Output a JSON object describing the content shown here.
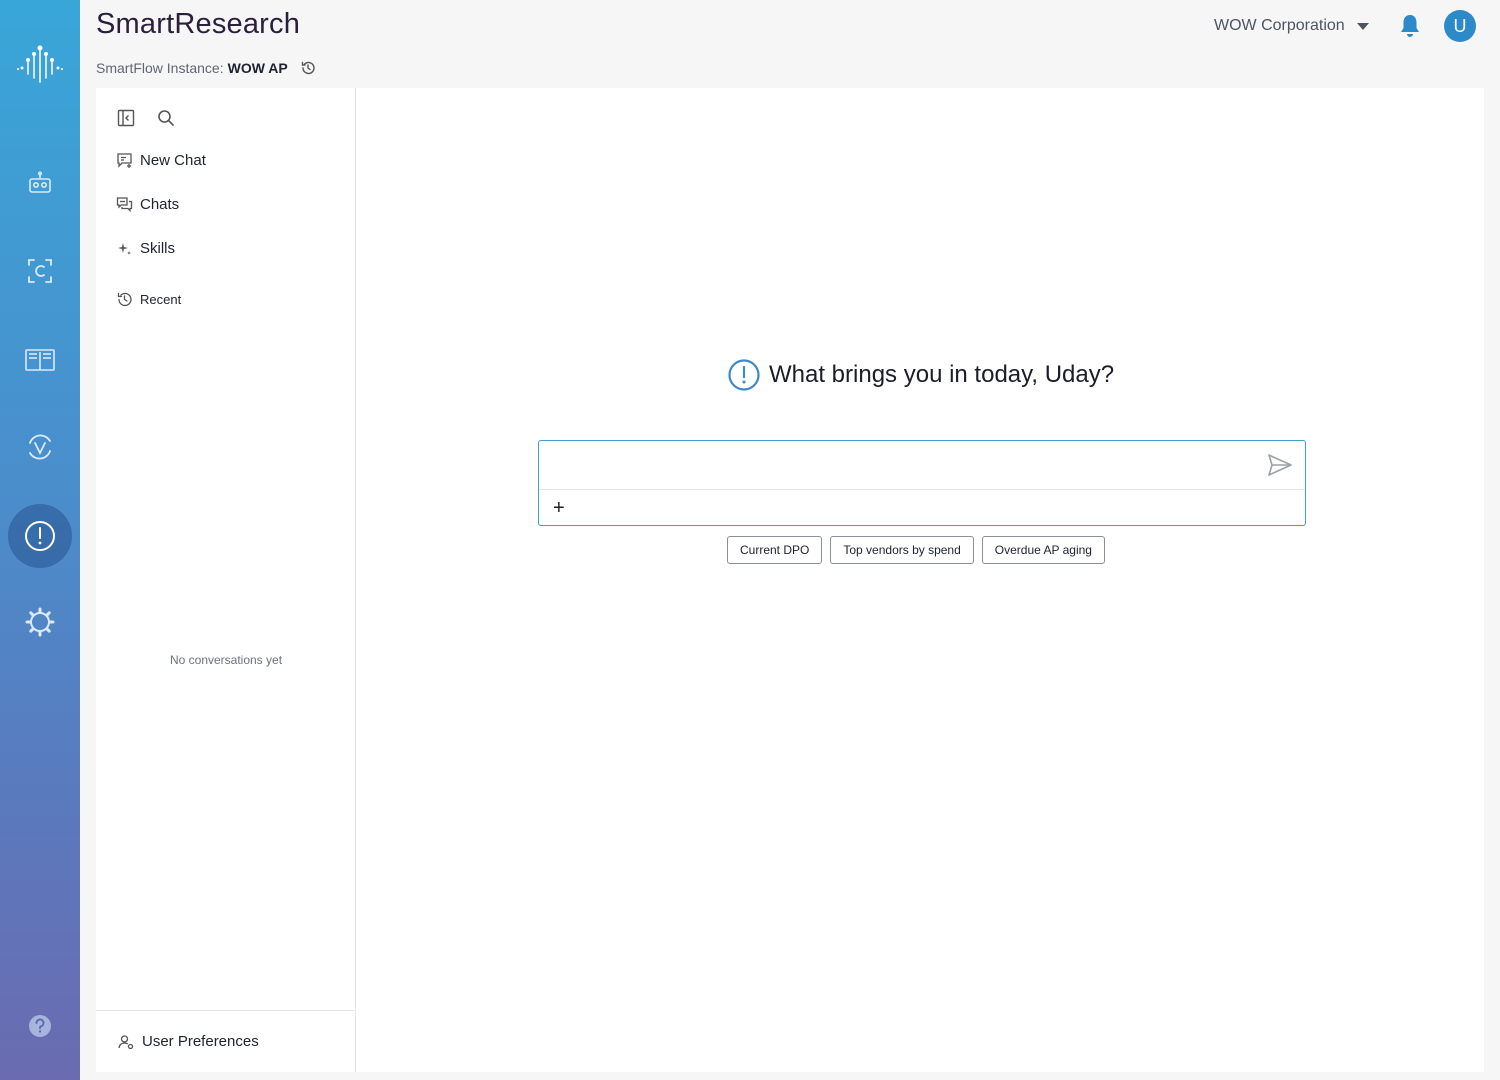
{
  "app": {
    "title": "SmartResearch",
    "instance_label": "SmartFlow Instance:",
    "instance_name": "WOW AP"
  },
  "header": {
    "organization": "WOW Corporation",
    "avatar_initial": "U"
  },
  "rail": {
    "items": [
      {
        "icon": "robot-icon"
      },
      {
        "icon": "smartcapture-icon"
      },
      {
        "icon": "book-icon"
      },
      {
        "icon": "validation-icon"
      },
      {
        "icon": "info-icon",
        "active": true
      },
      {
        "icon": "gear-icon"
      }
    ],
    "help_icon": "help-icon"
  },
  "sidebar": {
    "nav": [
      {
        "label": "New Chat",
        "icon": "new-chat-icon"
      },
      {
        "label": "Chats",
        "icon": "chats-icon"
      },
      {
        "label": "Skills",
        "icon": "sparkle-icon"
      },
      {
        "label": "Recent",
        "icon": "history-icon"
      }
    ],
    "empty_text": "No conversations yet",
    "footer_label": "User Preferences"
  },
  "main": {
    "greeting": "What brings you in today, Uday?",
    "input_value": "",
    "input_placeholder": "",
    "attach_label": "+",
    "suggestions": [
      "Current DPO",
      "Top vendors by spend",
      "Overdue AP aging"
    ]
  },
  "colors": {
    "accent": "#3f9ed0",
    "rail_top": "#39a6d8",
    "rail_bottom": "#6b6bb0",
    "avatar": "#2d8ac9"
  }
}
